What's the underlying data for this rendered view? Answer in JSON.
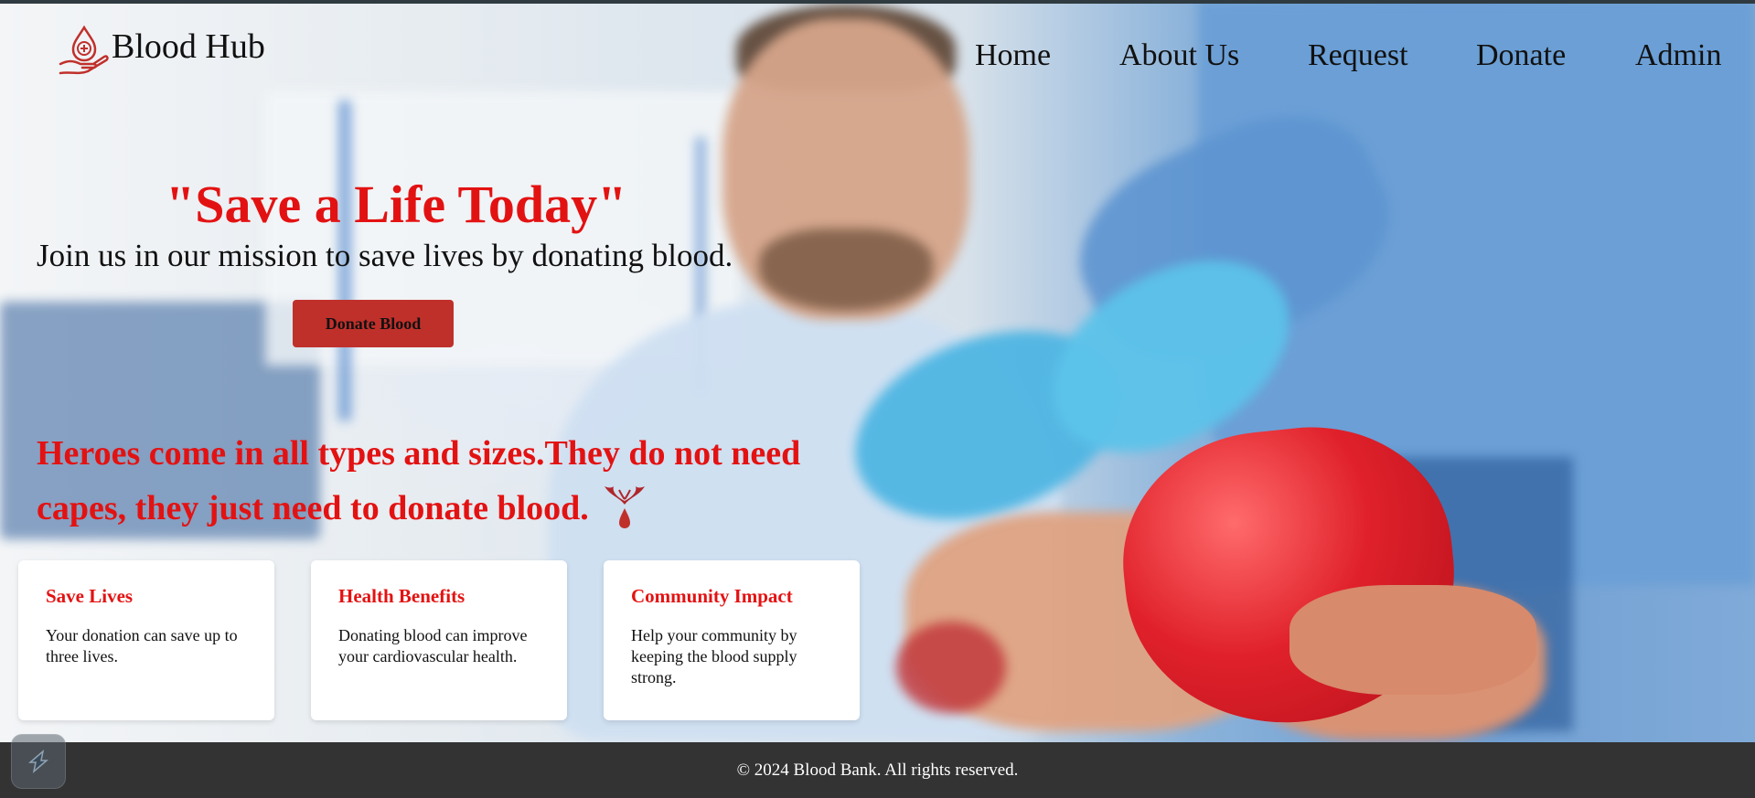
{
  "header": {
    "brand": "Blood Hub",
    "logo_icon": "hand-blood-drop-icon",
    "nav": [
      "Home",
      "About Us",
      "Request",
      "Donate",
      "Admin"
    ]
  },
  "hero": {
    "title": "\"Save a Life Today\"",
    "subtitle": "Join us in our mission to save lives by donating blood.",
    "cta_label": "Donate Blood",
    "quote": "Heroes come in all types and sizes.They do not need capes, they just need to donate blood.",
    "quote_icon": "heart-wings-drop-icon"
  },
  "cards": [
    {
      "title": "Save Lives",
      "text": "Your donation can save up to three lives."
    },
    {
      "title": "Health Benefits",
      "text": "Donating blood can improve your cardiovascular health."
    },
    {
      "title": "Community Impact",
      "text": "Help your community by keeping the blood supply strong."
    }
  ],
  "footer": {
    "text": "© 2024 Blood Bank. All rights reserved."
  },
  "floating_badge": {
    "icon": "app-logo-icon"
  },
  "colors": {
    "accent": "#e31212",
    "button": "#c0302b",
    "footer_bg": "#333333"
  }
}
